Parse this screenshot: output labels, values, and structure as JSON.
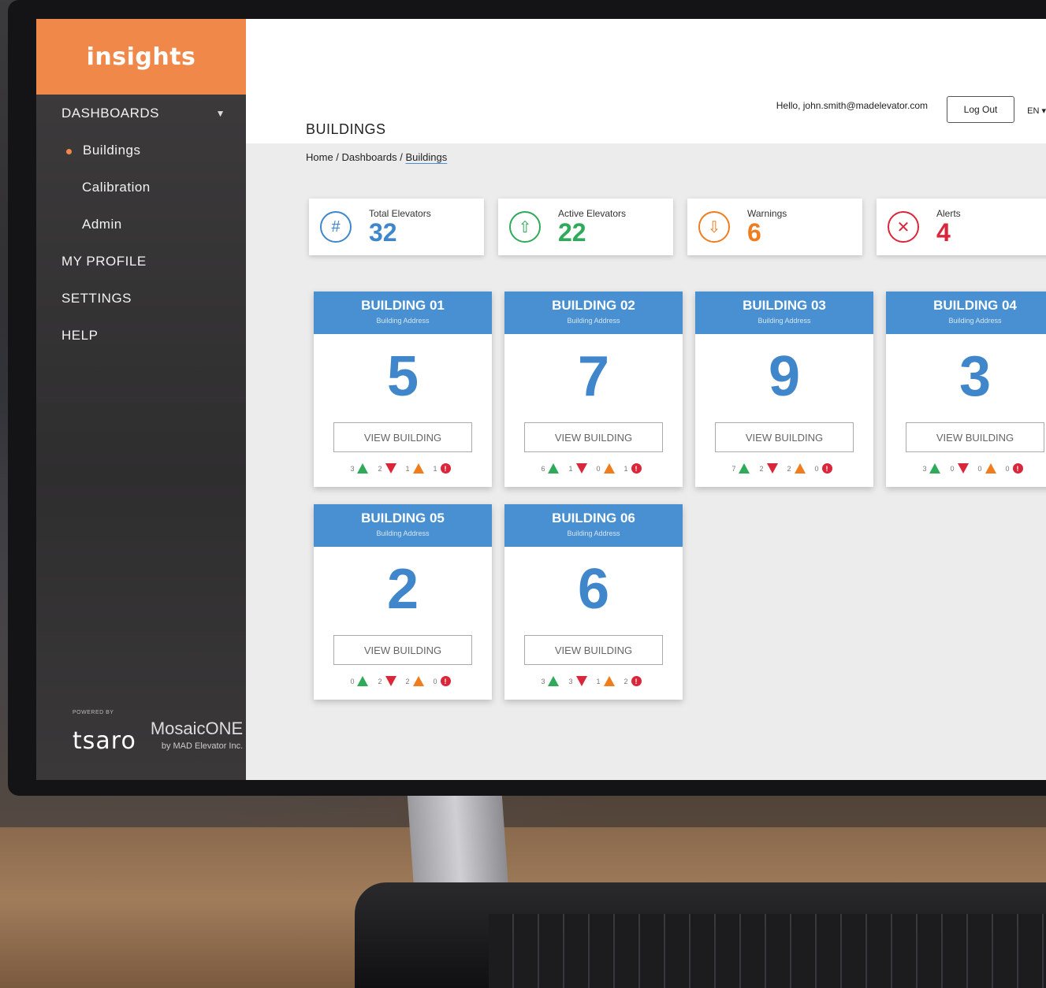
{
  "colors": {
    "accent": "#f0884a",
    "primary_blue": "#4890d2",
    "green": "#2faa5a",
    "red": "#d9263a",
    "orange": "#ef7d1e"
  },
  "sidebar": {
    "logo": "insights",
    "items": [
      {
        "label": "DASHBOARDS",
        "type": "section",
        "has_chevron": true
      },
      {
        "label": "Buildings",
        "type": "sub",
        "active": true
      },
      {
        "label": "Calibration",
        "type": "sub"
      },
      {
        "label": "Admin",
        "type": "sub"
      },
      {
        "label": "MY PROFILE",
        "type": "section"
      },
      {
        "label": "SETTINGS",
        "type": "section"
      },
      {
        "label": "HELP",
        "type": "section"
      }
    ],
    "footer": {
      "powered_by": "POWERED BY",
      "brand": "tsaro",
      "partner": "MosaicONE",
      "partner_sub": "by MAD Elevator Inc."
    }
  },
  "header": {
    "greeting": "Hello, john.smith@madelevator.com",
    "logout_label": "Log Out",
    "language": "EN"
  },
  "page": {
    "title": "BUILDINGS",
    "breadcrumb": {
      "home": "Home",
      "sep1": " / ",
      "dashboards": "Dashboards",
      "sep2": " / ",
      "current": "Buildings"
    }
  },
  "stats": [
    {
      "label": "Total Elevators",
      "value": "32",
      "icon": "hash-icon",
      "color": "#3f86cb"
    },
    {
      "label": "Active Elevators",
      "value": "22",
      "icon": "arrow-up-icon",
      "color": "#2faa5a"
    },
    {
      "label": "Warnings",
      "value": "6",
      "icon": "arrow-down-icon",
      "color": "#ef7d1e"
    },
    {
      "label": "Alerts",
      "value": "4",
      "icon": "x-circle-icon",
      "color": "#d9263a"
    }
  ],
  "buildings": [
    {
      "name": "BUILDING 01",
      "address": "Building Address",
      "count": "5",
      "button": "VIEW BUILDING",
      "up": "3",
      "down": "2",
      "warn": "1",
      "alert": "1"
    },
    {
      "name": "BUILDING 02",
      "address": "Building Address",
      "count": "7",
      "button": "VIEW BUILDING",
      "up": "6",
      "down": "1",
      "warn": "0",
      "alert": "1"
    },
    {
      "name": "BUILDING 03",
      "address": "Building Address",
      "count": "9",
      "button": "VIEW BUILDING",
      "up": "7",
      "down": "2",
      "warn": "2",
      "alert": "0"
    },
    {
      "name": "BUILDING 04",
      "address": "Building Address",
      "count": "3",
      "button": "VIEW BUILDING",
      "up": "3",
      "down": "0",
      "warn": "0",
      "alert": "0"
    },
    {
      "name": "BUILDING 05",
      "address": "Building Address",
      "count": "2",
      "button": "VIEW BUILDING",
      "up": "0",
      "down": "2",
      "warn": "2",
      "alert": "0"
    },
    {
      "name": "BUILDING 06",
      "address": "Building Address",
      "count": "6",
      "button": "VIEW BUILDING",
      "up": "3",
      "down": "3",
      "warn": "1",
      "alert": "2"
    }
  ]
}
